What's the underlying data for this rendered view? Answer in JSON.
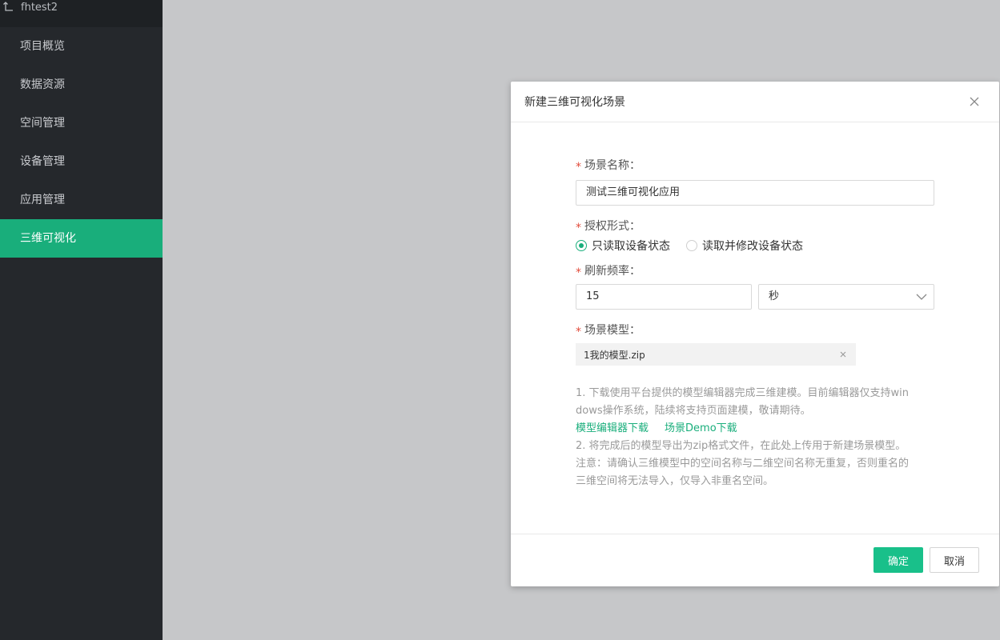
{
  "sidebar": {
    "project_name": "fhtest2",
    "items": [
      {
        "label": "项目概览"
      },
      {
        "label": "数据资源"
      },
      {
        "label": "空间管理"
      },
      {
        "label": "设备管理"
      },
      {
        "label": "应用管理"
      },
      {
        "label": "三维可视化",
        "active": true
      }
    ]
  },
  "modal": {
    "title": "新建三维可视化场景",
    "fields": {
      "scene_name": {
        "label": "场景名称：",
        "value": "测试三维可视化应用"
      },
      "auth": {
        "label": "授权形式：",
        "options": [
          {
            "label": "只读取设备状态",
            "checked": true
          },
          {
            "label": "读取并修改设备状态",
            "checked": false
          }
        ]
      },
      "refresh": {
        "label": "刷新频率：",
        "value": "15",
        "unit": "秒"
      },
      "model": {
        "label": "场景模型：",
        "file_name": "1我的模型.zip"
      }
    },
    "help": {
      "line1a": "1. 下载使用平台提供的模型编辑器完成三维建模。目前编辑器仅支持win",
      "line1b": "dows操作系统，陆续将支持页面建模，敬请期待。",
      "link_editor": "模型编辑器下载",
      "link_demo": "场景Demo下载",
      "line2": "2. 将完成后的模型导出为zip格式文件，在此处上传用于新建场景模型。",
      "line3a": "注意：请确认三维模型中的空间名称与二维空间名称无重复，否则重名的",
      "line3b": "三维空间将无法导入，仅导入非重名空间。"
    },
    "buttons": {
      "ok": "确定",
      "cancel": "取消"
    }
  },
  "colors": {
    "accent": "#19ae7b",
    "required": "#e24c3c",
    "sidebar_bg": "#25282c"
  }
}
